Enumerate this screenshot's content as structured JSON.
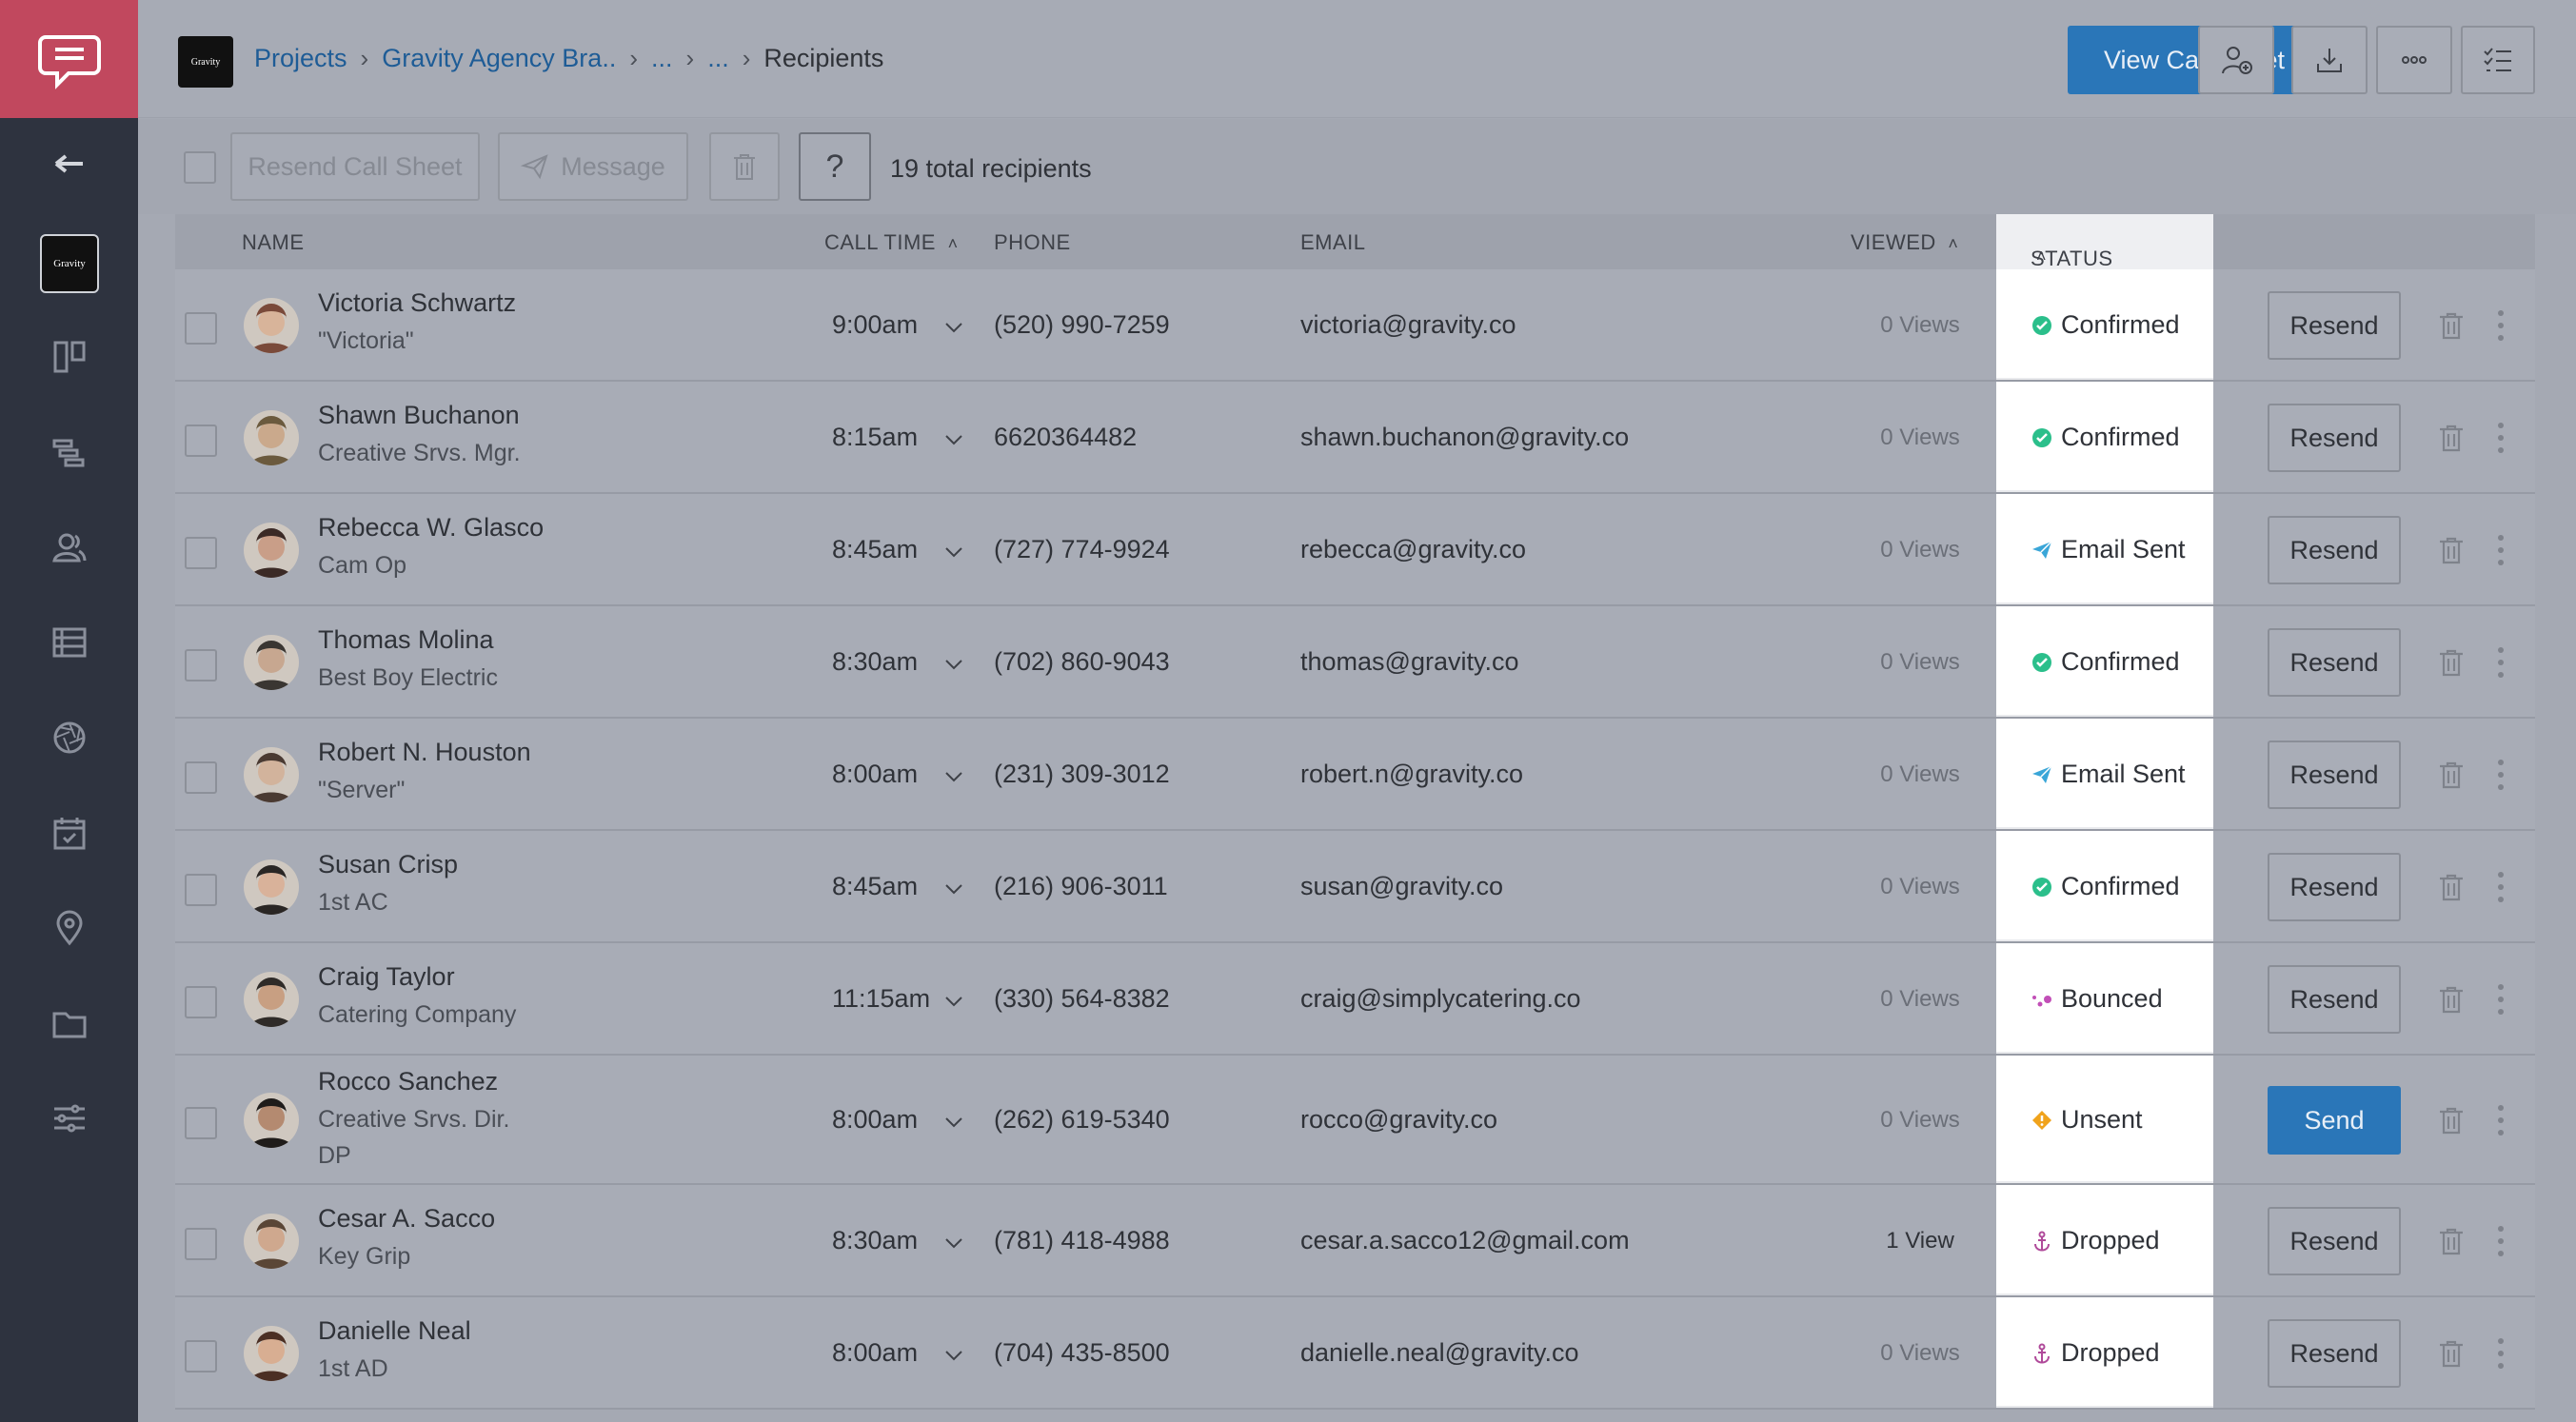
{
  "colors": {
    "brand": "#c1485e",
    "sidebar": "#2e333f",
    "primary": "#2a76b8",
    "confirmed": "#2bbf8b",
    "email_sent": "#3aa6d8",
    "bounced": "#c24fb7",
    "unsent": "#f0a31c",
    "dropped": "#b04a9a"
  },
  "sidebar": {
    "project_thumb": "Gravity",
    "icons": [
      "chat-bubble-icon",
      "back-arrow-icon",
      "board-icon",
      "timeline-icon",
      "contacts-icon",
      "stripboard-icon",
      "aperture-icon",
      "calendar-check-icon",
      "location-pin-icon",
      "folder-icon",
      "sliders-icon"
    ]
  },
  "header": {
    "thumb": "Gravity",
    "breadcrumb": {
      "projects": "Projects",
      "project": "Gravity Agency Bra..",
      "ellipsis1": "...",
      "ellipsis2": "...",
      "current": "Recipients"
    },
    "view_call_sheet": "View Call Sheet"
  },
  "toolbar": {
    "resend": "Resend Call Sheet",
    "message": "Message",
    "help": "?",
    "total": "19 total recipients"
  },
  "table": {
    "columns": {
      "name": "NAME",
      "call_time": "CALL TIME",
      "phone": "PHONE",
      "email": "EMAIL",
      "viewed": "VIEWED",
      "status": "STATUS"
    },
    "rows": [
      {
        "name": "Victoria Schwartz",
        "roles": [
          "\"Victoria\""
        ],
        "time": "9:00am",
        "phone": "(520) 990-7259",
        "email": "victoria@gravity.co",
        "views": "0 Views",
        "status": "Confirmed",
        "status_type": "confirmed",
        "action": "Resend"
      },
      {
        "name": "Shawn Buchanon",
        "roles": [
          "Creative Srvs. Mgr."
        ],
        "time": "8:15am",
        "phone": "6620364482",
        "email": "shawn.buchanon@gravity.co",
        "views": "0 Views",
        "status": "Confirmed",
        "status_type": "confirmed",
        "action": "Resend"
      },
      {
        "name": "Rebecca W. Glasco",
        "roles": [
          "Cam Op"
        ],
        "time": "8:45am",
        "phone": "(727) 774-9924",
        "email": "rebecca@gravity.co",
        "views": "0 Views",
        "status": "Email Sent",
        "status_type": "sent",
        "action": "Resend"
      },
      {
        "name": "Thomas Molina",
        "roles": [
          "Best Boy Electric"
        ],
        "time": "8:30am",
        "phone": "(702) 860-9043",
        "email": "thomas@gravity.co",
        "views": "0 Views",
        "status": "Confirmed",
        "status_type": "confirmed",
        "action": "Resend"
      },
      {
        "name": "Robert N. Houston",
        "roles": [
          "\"Server\""
        ],
        "time": "8:00am",
        "phone": "(231) 309-3012",
        "email": "robert.n@gravity.co",
        "views": "0 Views",
        "status": "Email Sent",
        "status_type": "sent",
        "action": "Resend"
      },
      {
        "name": "Susan Crisp",
        "roles": [
          "1st AC"
        ],
        "time": "8:45am",
        "phone": "(216) 906-3011",
        "email": "susan@gravity.co",
        "views": "0 Views",
        "status": "Confirmed",
        "status_type": "confirmed",
        "action": "Resend"
      },
      {
        "name": "Craig Taylor",
        "roles": [
          "Catering Company"
        ],
        "time": "11:15am",
        "phone": "(330) 564-8382",
        "email": "craig@simplycatering.co",
        "views": "0 Views",
        "status": "Bounced",
        "status_type": "bounced",
        "action": "Resend"
      },
      {
        "name": "Rocco Sanchez",
        "roles": [
          "Creative Srvs. Dir.",
          "DP"
        ],
        "time": "8:00am",
        "phone": "(262) 619-5340",
        "email": "rocco@gravity.co",
        "views": "0 Views",
        "status": "Unsent",
        "status_type": "unsent",
        "action": "Send"
      },
      {
        "name": "Cesar A. Sacco",
        "roles": [
          "Key Grip"
        ],
        "time": "8:30am",
        "phone": "(781) 418-4988",
        "email": "cesar.a.sacco12@gmail.com",
        "views": "1 View",
        "status": "Dropped",
        "status_type": "dropped",
        "action": "Resend"
      },
      {
        "name": "Danielle Neal",
        "roles": [
          "1st AD"
        ],
        "time": "8:00am",
        "phone": "(704) 435-8500",
        "email": "danielle.neal@gravity.co",
        "views": "0 Views",
        "status": "Dropped",
        "status_type": "dropped",
        "action": "Resend"
      }
    ]
  }
}
